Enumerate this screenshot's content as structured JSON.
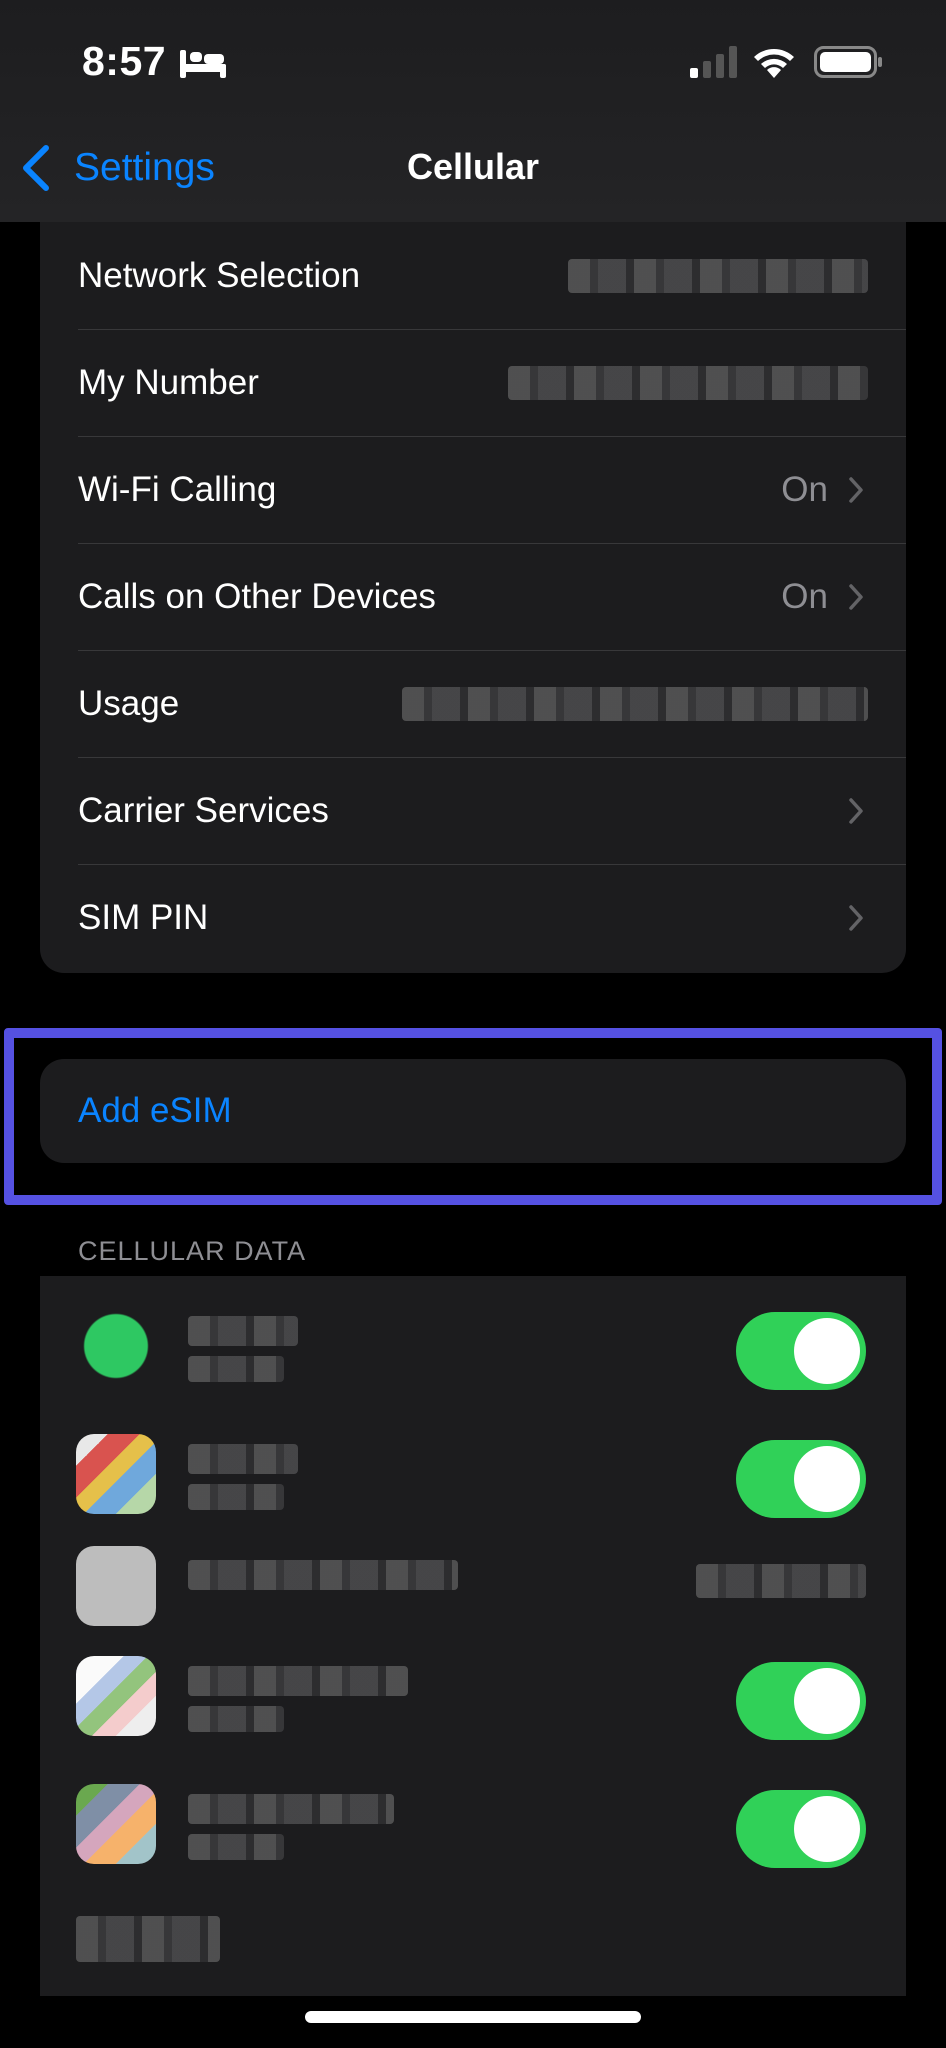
{
  "status_bar": {
    "time": "8:57"
  },
  "nav": {
    "back_label": "Settings",
    "title": "Cellular"
  },
  "settings_rows": [
    {
      "label": "Network Selection",
      "value": ""
    },
    {
      "label": "My Number",
      "value": ""
    },
    {
      "label": "Wi-Fi Calling",
      "value": "On"
    },
    {
      "label": "Calls on Other Devices",
      "value": "On"
    },
    {
      "label": "Usage",
      "value": ""
    },
    {
      "label": "Carrier Services",
      "value": ""
    },
    {
      "label": "SIM PIN",
      "value": ""
    }
  ],
  "esim": {
    "label": "Add eSIM"
  },
  "cellular_data": {
    "header": "CELLULAR DATA",
    "apps": [
      {
        "toggle": "on"
      },
      {
        "toggle": "on"
      },
      {
        "toggle": "none"
      },
      {
        "toggle": "on"
      },
      {
        "toggle": "on"
      },
      {
        "toggle": "none"
      }
    ]
  },
  "colors": {
    "accent": "#0a84ff",
    "toggle_on": "#30d158",
    "highlight": "#5551e2"
  }
}
